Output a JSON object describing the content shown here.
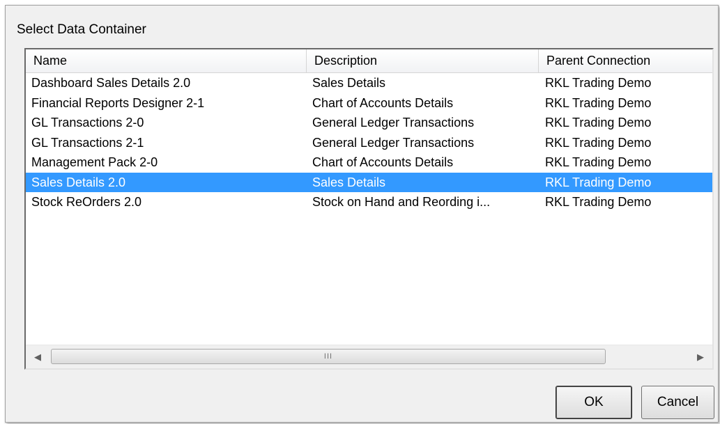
{
  "dialog": {
    "title": "Select Data Container",
    "columns": [
      "Name",
      "Description",
      "Parent Connection"
    ],
    "rows": [
      {
        "name": "Dashboard Sales Details 2.0",
        "description": "Sales Details",
        "parent": "RKL Trading Demo"
      },
      {
        "name": "Financial Reports Designer 2-1",
        "description": "Chart of Accounts Details",
        "parent": "RKL Trading Demo"
      },
      {
        "name": "GL Transactions 2-0",
        "description": "General Ledger Transactions",
        "parent": "RKL Trading Demo"
      },
      {
        "name": "GL Transactions 2-1",
        "description": "General Ledger Transactions",
        "parent": "RKL Trading Demo"
      },
      {
        "name": "Management Pack 2-0",
        "description": "Chart of Accounts Details",
        "parent": "RKL Trading Demo"
      },
      {
        "name": "Sales Details 2.0",
        "description": "Sales Details",
        "parent": "RKL Trading Demo"
      },
      {
        "name": "Stock ReOrders 2.0",
        "description": "Stock on Hand and Reording i...",
        "parent": "RKL Trading Demo"
      }
    ],
    "selected_row": "Sales Details 2.0",
    "scrollbar": {
      "left_arrow_icon": "scroll-left-arrow",
      "right_arrow_icon": "scroll-right-arrow",
      "grip_icon": "scroll-grip"
    },
    "buttons": {
      "ok_label": "OK",
      "cancel_label": "Cancel"
    }
  },
  "colors": {
    "selection": "#3399ff",
    "dialog_background": "#f0f0f0"
  }
}
